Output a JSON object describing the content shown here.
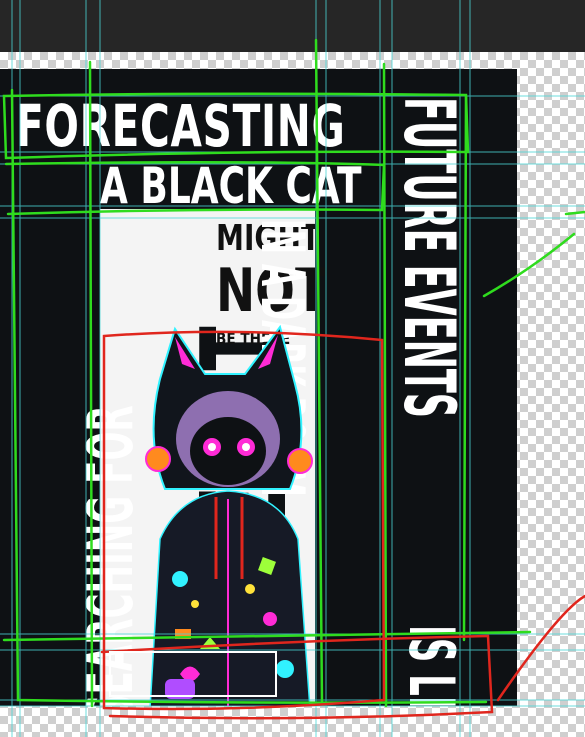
{
  "artwork": {
    "line_1": "FORECASTING",
    "line_2": "A BLACK CAT",
    "line_3": "MIGHT",
    "line_4": "NOT",
    "line_5": "BE THERE",
    "vertical_left": "SEARCHING FOR",
    "vertical_center": "THE CAT",
    "vertical_middle": "IN A DARK ROOM",
    "vertical_right": "FUTURE EVENTS",
    "vertical_bottom_right": "IS LIKE"
  },
  "colors": {
    "artwork_background": "#0e1114",
    "guide_line": "#49d6d6",
    "green_annotation": "#2fdc1e",
    "red_annotation": "#e0261d",
    "neon_magenta": "#ff2bd6",
    "neon_cyan": "#31f2ff"
  }
}
